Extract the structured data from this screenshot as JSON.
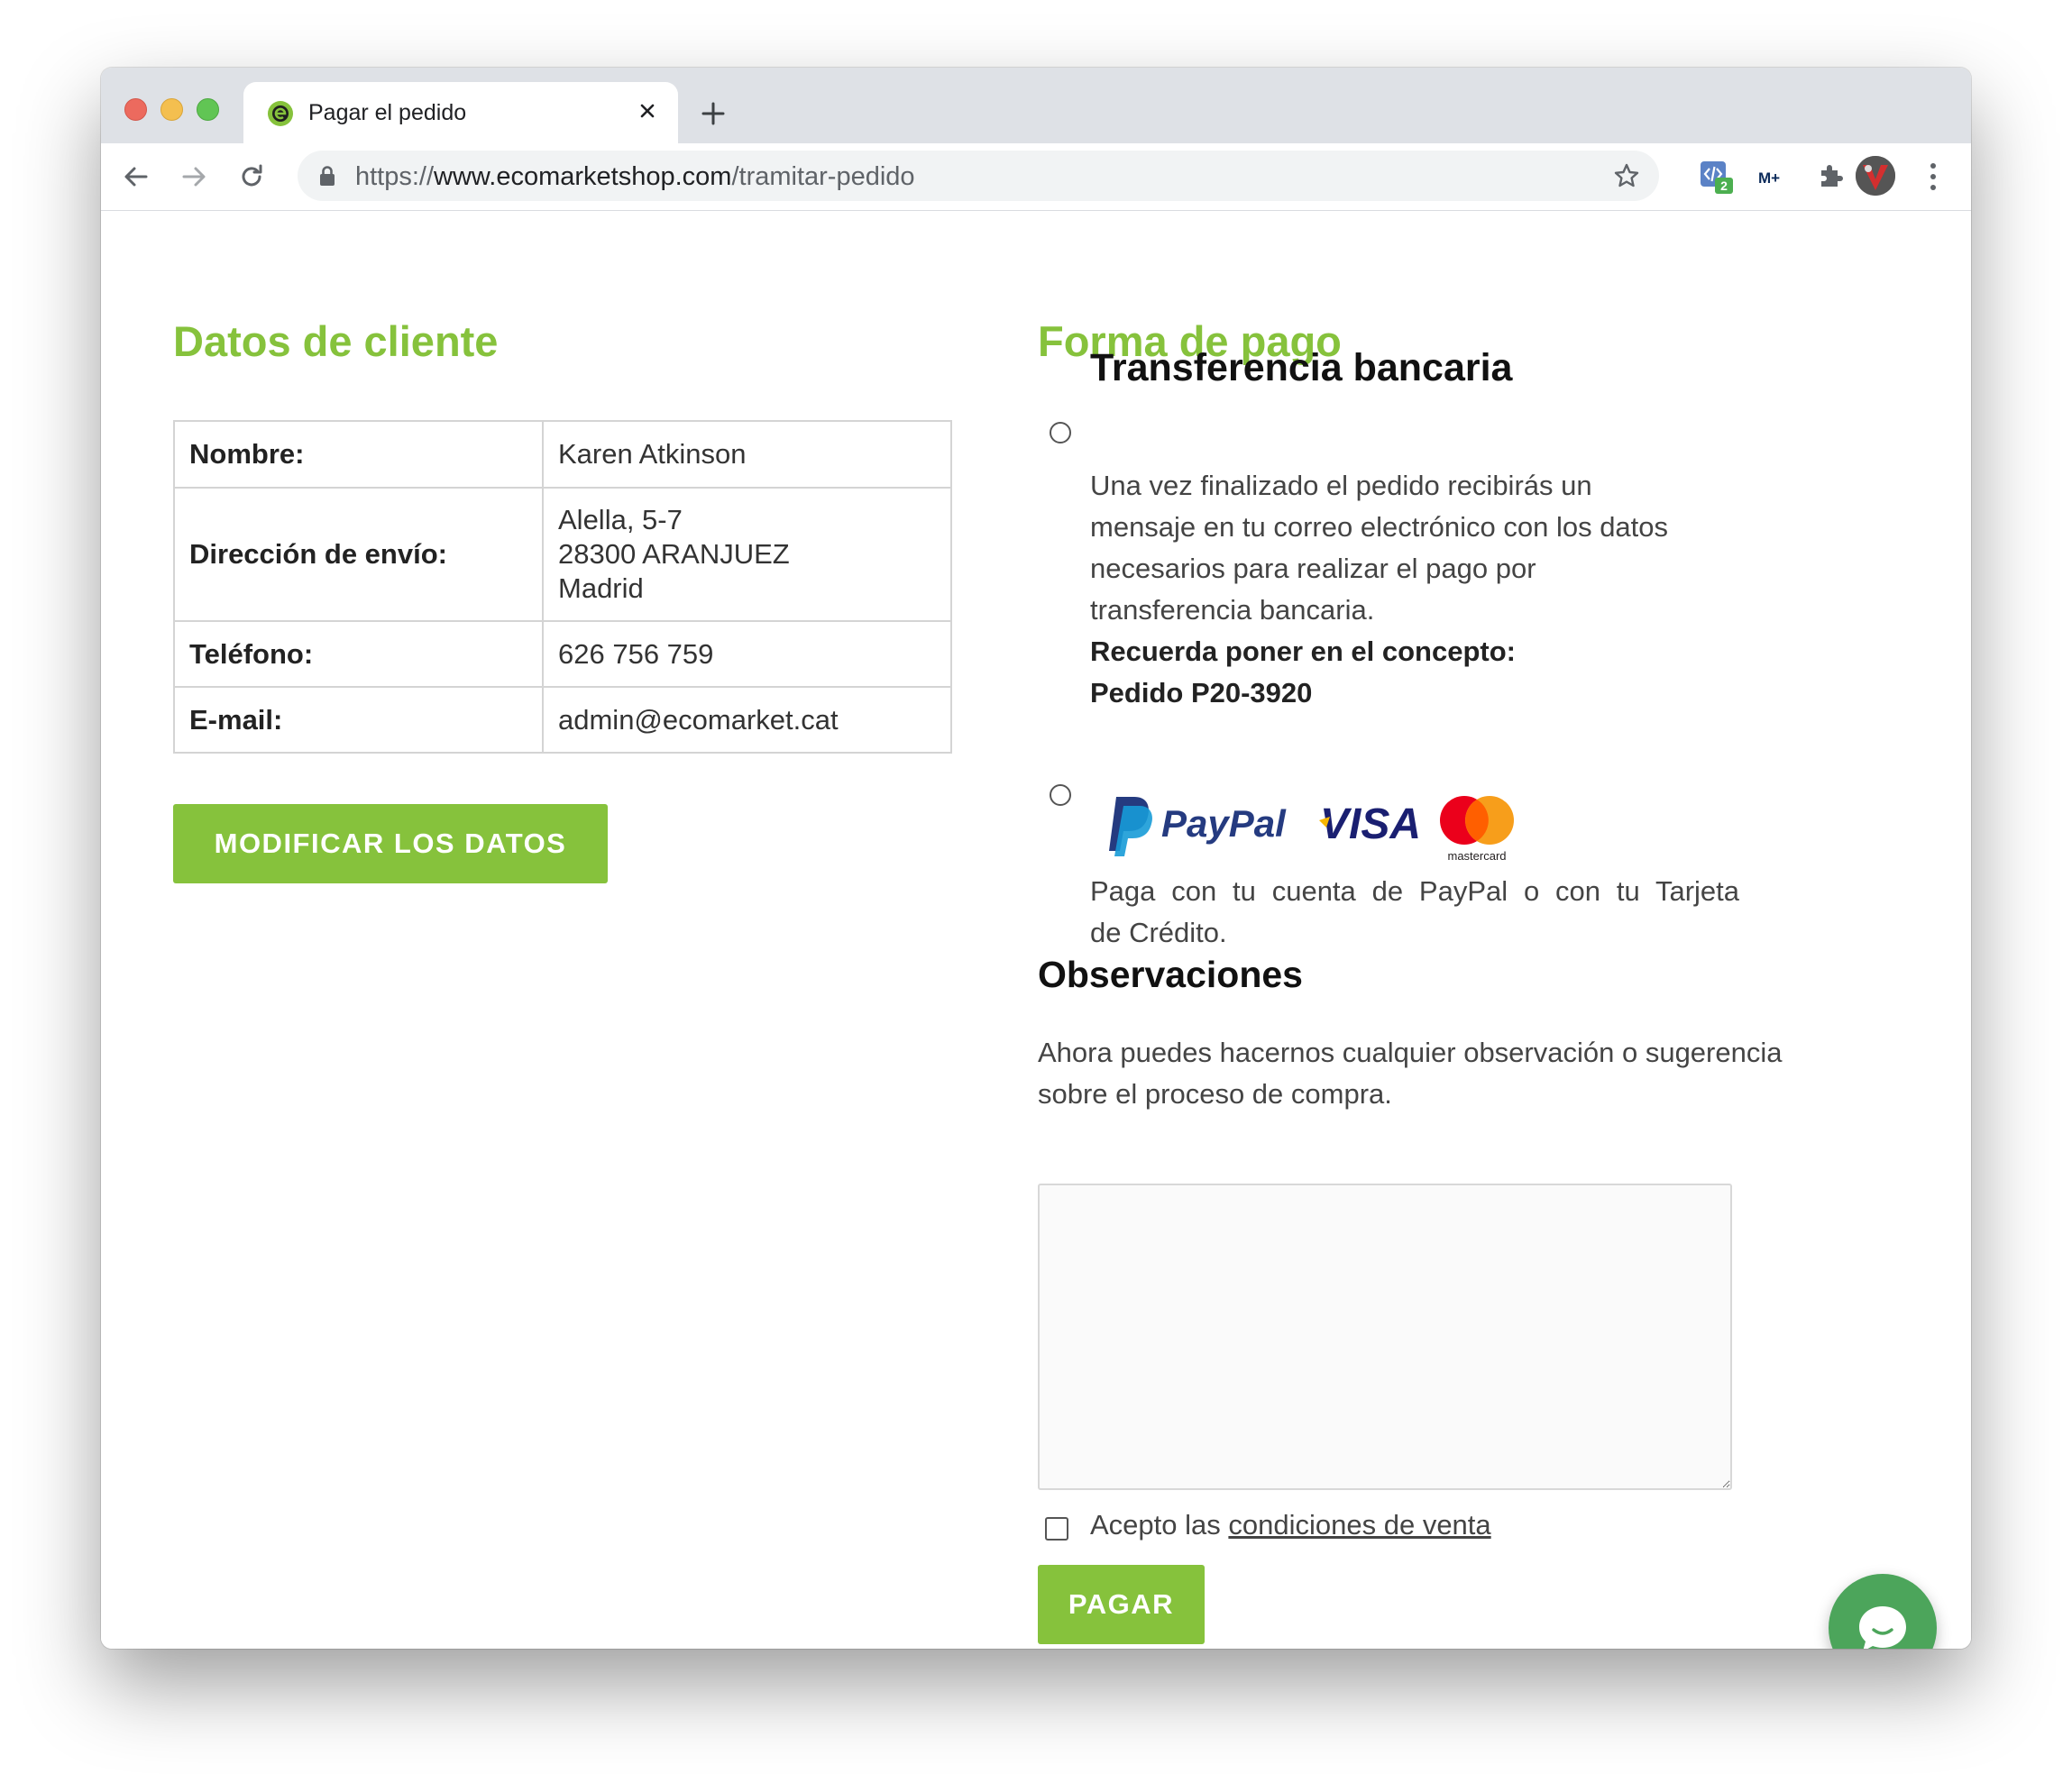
{
  "browser": {
    "tab_title": "Pagar el pedido",
    "url_scheme": "https://",
    "url_host": "www.ecomarketshop.com",
    "url_path": "/tramitar-pedido",
    "extension_badge": "2",
    "extension_text": "M+"
  },
  "customer": {
    "heading": "Datos de cliente",
    "rows": [
      {
        "label": "Nombre:",
        "lines": [
          "Karen Atkinson"
        ]
      },
      {
        "label": "Dirección de envío:",
        "lines": [
          "Alella, 5-7",
          "28300 ARANJUEZ",
          "Madrid"
        ]
      },
      {
        "label": "Teléfono:",
        "lines": [
          "626 756 759"
        ]
      },
      {
        "label": "E-mail:",
        "lines": [
          "admin@ecomarket.cat"
        ]
      }
    ],
    "modify_button": "MODIFICAR LOS DATOS"
  },
  "payment": {
    "heading": "Forma de pago",
    "transfer": {
      "title": "Transferencia bancaria",
      "description_lines": [
        "Una vez finalizado el pedido recibirás un",
        "mensaje en tu correo electrónico con los datos",
        "necesarios para realizar el pago por",
        "transferencia bancaria."
      ],
      "note_line1": "Recuerda poner en el concepto:",
      "note_line2": "Pedido P20-3920"
    },
    "card": {
      "logo_paypal": "PayPal",
      "logo_visa": "VISA",
      "logo_mastercard": "mastercard",
      "description_line1": "Paga con tu cuenta de PayPal o con tu Tarjeta",
      "description_line2": "de Crédito."
    }
  },
  "observations": {
    "heading": "Observaciones",
    "intro_line1": "Ahora puedes hacernos cualquier observación o sugerencia",
    "intro_line2": "sobre el proceso de compra.",
    "textarea_value": ""
  },
  "terms": {
    "prefix": "Acepto las",
    "link": "condiciones de venta"
  },
  "pay_button": "PAGAR",
  "colors": {
    "accent_green": "#86c23c",
    "chat_green": "#4ca55b",
    "paypal_dark": "#253b80",
    "paypal_light": "#179bd7",
    "visa_blue": "#1a1f71"
  }
}
